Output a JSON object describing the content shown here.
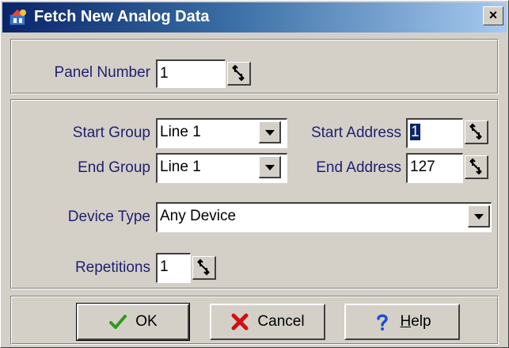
{
  "window": {
    "title": "Fetch New Analog Data",
    "close_glyph": "×"
  },
  "panel": {
    "label": "Panel Number",
    "value": "1"
  },
  "range": {
    "start_group_label": "Start Group",
    "start_group_value": "Line 1",
    "end_group_label": "End Group",
    "end_group_value": "Line 1",
    "start_address_label": "Start Address",
    "start_address_value": "1",
    "end_address_label": "End Address",
    "end_address_value": "127",
    "device_type_label": "Device Type",
    "device_type_value": "Any Device",
    "repetitions_label": "Repetitions",
    "repetitions_value": "1"
  },
  "buttons": {
    "ok_label": "OK",
    "cancel_label": "Cancel",
    "help_mnemonic": "H",
    "help_rest": "elp"
  },
  "colors": {
    "accent": "#0a246a",
    "label_text": "#1f1f6e",
    "ok_icon": "#2e9a1e",
    "cancel_icon": "#d01010",
    "help_icon": "#1f4fd1"
  }
}
